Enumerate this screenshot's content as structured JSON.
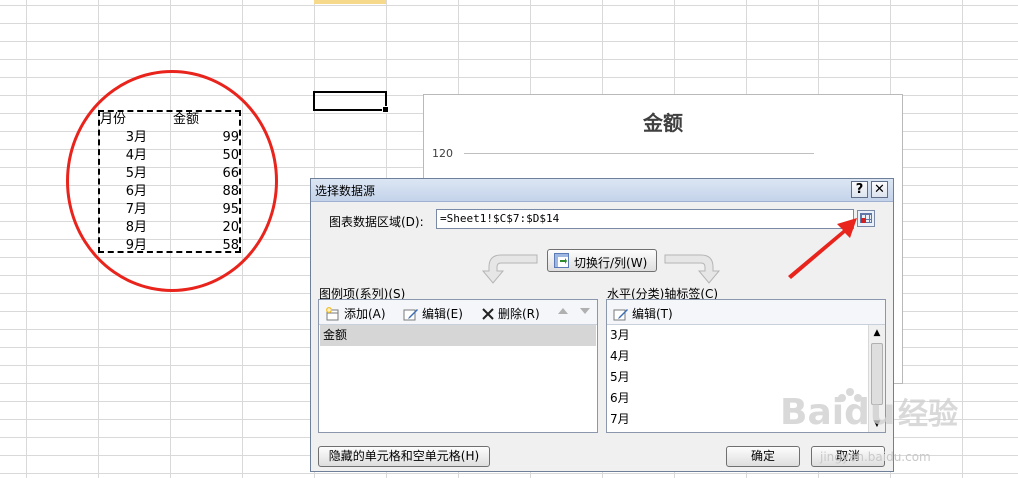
{
  "sheet": {
    "header_month": "月份",
    "header_amount": "金额",
    "rows": [
      {
        "month": "3月",
        "amount": "99"
      },
      {
        "month": "4月",
        "amount": "50"
      },
      {
        "month": "5月",
        "amount": "66"
      },
      {
        "month": "6月",
        "amount": "88"
      },
      {
        "month": "7月",
        "amount": "95"
      },
      {
        "month": "8月",
        "amount": "20"
      },
      {
        "month": "9月",
        "amount": "58"
      }
    ]
  },
  "chart": {
    "title": "金额",
    "tick_top": "120"
  },
  "dialog": {
    "title": "选择数据源",
    "help_label": "?",
    "close_label": "✕",
    "range_label": "图表数据区域(D):",
    "range_value": "=Sheet1!$C$7:$D$14",
    "switch_label": "切换行/列(W)",
    "legend_label": "图例项(系列)(S)",
    "legend_tools": {
      "add": "添加(A)",
      "edit": "编辑(E)",
      "delete": "删除(R)"
    },
    "series": [
      "金额"
    ],
    "axis_label": "水平(分类)轴标签(C)",
    "axis_tools": {
      "edit": "编辑(T)"
    },
    "categories": [
      "3月",
      "4月",
      "5月",
      "6月",
      "7月"
    ],
    "hidden_cells_label": "隐藏的单元格和空单元格(H)",
    "ok_label": "确定",
    "cancel_label": "取消"
  },
  "watermark": {
    "brand": "Baidu",
    "brand_cn": "经验",
    "url": "jingyan.baidu.com"
  },
  "colors": {
    "annotation": "#e8241c",
    "title_bar": "#c4d3ea",
    "selection": "#d6d6d6"
  }
}
